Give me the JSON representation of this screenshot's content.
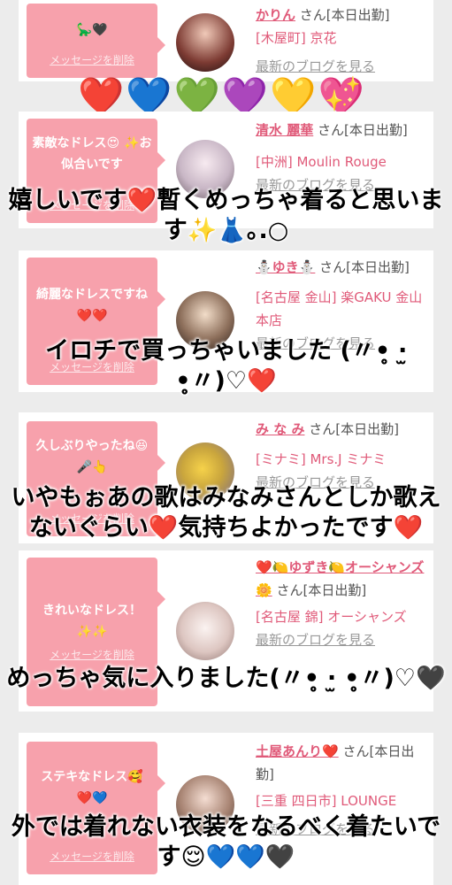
{
  "cards": [
    {
      "bubble_msg": "🦕🖤",
      "delete_label": "メッセージを削除",
      "name": "かりん",
      "suffix": "さん[本日出勤]",
      "area": "[木屋町] 京花",
      "blog": "最新のブログを見る"
    },
    {
      "bubble_msg": "素敵なドレス😍 ✨お似合いです",
      "delete_label": "メッセージを削除",
      "name": "清水 麗華",
      "suffix": "さん[本日出勤]",
      "area": "[中洲] Moulin Rouge",
      "blog": "最新のブログを見る"
    },
    {
      "bubble_msg": "綺麗なドレスですね❤️❤️",
      "delete_label": "メッセージを削除",
      "name": "⛄ゆき⛄",
      "suffix": "さん[本日出勤]",
      "area": "[名古屋 金山] 楽GAKU 金山本店",
      "blog": "最新のブログを見る"
    },
    {
      "bubble_msg": "久しぶりやったね😆🎤👆",
      "delete_label": "メッセージを削除",
      "name": "み な み",
      "suffix": "さん[本日出勤]",
      "area": "[ミナミ] Mrs.J ミナミ",
      "blog": "最新のブログを見る"
    },
    {
      "bubble_msg": "きれいなドレス！ ✨✨",
      "delete_label": "メッセージを削除",
      "name": "❤️🍋ゆずき🍋オーシャンズ🌼",
      "suffix": "さん[本日出勤]",
      "area": "[名古屋 錦] オーシャンズ",
      "blog": "最新のブログを見る"
    },
    {
      "bubble_msg": "ステキなドレス🥰 ❤️💙",
      "delete_label": "メッセージを削除",
      "name": "土屋あんり❤️",
      "suffix": "さん[本日出勤]",
      "area": "[三重 四日市] LOUNGE",
      "blog": "最新のブログを見る"
    }
  ],
  "heart_row": "❤️💙💚💜💛💖",
  "captions": [
    "嬉しいです❤️暫くめっちゃ着ると思います✨👗｡.○",
    "イロチで買っちゃいました (〃•̥̥̥ ‧̫ •̥̥̥〃)♡❤️",
    "いやもぉあの歌はみなみさんとしか歌えないぐらい❤️気持ちよかったです❤️",
    "めっちゃ気に入りました(〃•̥̥̥ ‧̫ •̥̥̥〃)♡🖤",
    "外では着れない衣装をなるべく着たいです😌💙💙🖤"
  ]
}
